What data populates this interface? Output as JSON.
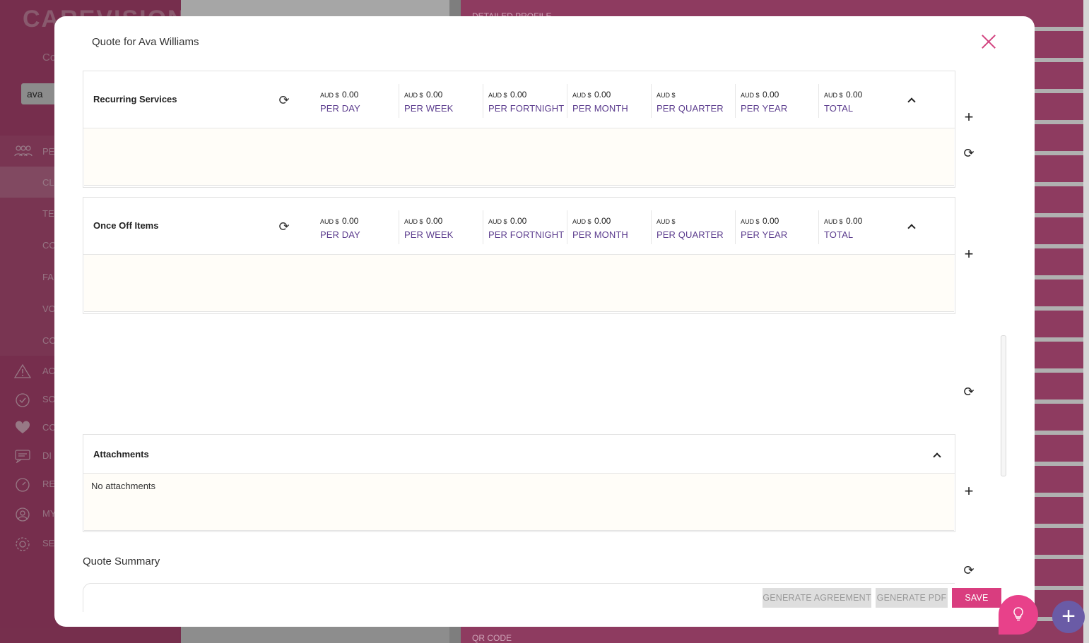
{
  "background": {
    "logo": "CAREVISION",
    "company_label": "Co",
    "search_value": "ava",
    "nav": [
      {
        "icon": "people-icon",
        "label": "PE"
      },
      {
        "icon": "",
        "label": "CL"
      },
      {
        "icon": "",
        "label": "TE"
      },
      {
        "icon": "",
        "label": "CO"
      },
      {
        "icon": "",
        "label": "FA"
      },
      {
        "icon": "",
        "label": "VO"
      },
      {
        "icon": "",
        "label": "CO"
      },
      {
        "icon": "alert-icon",
        "label": "AC"
      },
      {
        "icon": "schedule-icon",
        "label": "SC"
      },
      {
        "icon": "heart-icon",
        "label": "CO"
      },
      {
        "icon": "chat-icon",
        "label": "DI"
      },
      {
        "icon": "report-icon",
        "label": "RE"
      },
      {
        "icon": "user-icon",
        "label": "MY"
      },
      {
        "icon": "settings-icon",
        "label": "SE"
      }
    ],
    "right_labels": [
      "DETAILED PROFILE",
      "QR CODE"
    ]
  },
  "modal": {
    "title": "Quote for Ava Williams"
  },
  "currency_prefix": "AUD $",
  "recurring": {
    "name": "Recurring Services",
    "columns": [
      {
        "value": "0.00",
        "period": "PER DAY"
      },
      {
        "value": "0.00",
        "period": "PER WEEK"
      },
      {
        "value": "0.00",
        "period": "PER FORTNIGHT"
      },
      {
        "value": "0.00",
        "period": "PER MONTH"
      },
      {
        "value": "",
        "period": "PER QUARTER"
      },
      {
        "value": "0.00",
        "period": "PER YEAR"
      },
      {
        "value": "0.00",
        "period": "TOTAL"
      }
    ]
  },
  "onceoff": {
    "name": "Once Off Items",
    "columns": [
      {
        "value": "0.00",
        "period": "PER DAY"
      },
      {
        "value": "0.00",
        "period": "PER WEEK"
      },
      {
        "value": "0.00",
        "period": "PER FORTNIGHT"
      },
      {
        "value": "0.00",
        "period": "PER MONTH"
      },
      {
        "value": "",
        "period": "PER QUARTER"
      },
      {
        "value": "0.00",
        "period": "PER YEAR"
      },
      {
        "value": "0.00",
        "period": "TOTAL"
      }
    ]
  },
  "attachments": {
    "title": "Attachments",
    "empty_text": "No attachments"
  },
  "summary": {
    "title": "Quote Summary"
  },
  "buttons": {
    "generate_agreement": "GENERATE AGREEMENT",
    "generate_pdf": "GENERATE PDF",
    "save": "SAVE"
  },
  "colors": {
    "accent": "#d93d7f",
    "period_text": "#5c3d8e",
    "sidebar": "#b64877"
  }
}
